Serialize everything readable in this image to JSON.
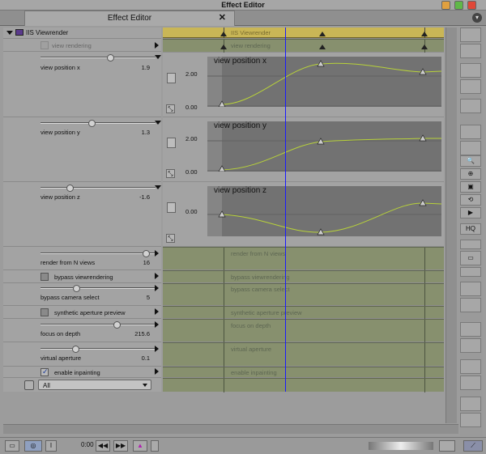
{
  "window": {
    "title": "Effect Editor"
  },
  "tab": {
    "label": "Effect Editor",
    "close": "✕"
  },
  "effect": {
    "name": "IIS Viewrender"
  },
  "params": {
    "view_rendering": {
      "label": "view rendering"
    },
    "view_position_x": {
      "label": "view position x",
      "value": "1.9",
      "slider": 0.62
    },
    "view_position_y": {
      "label": "view position y",
      "value": "1.3",
      "slider": 0.44
    },
    "view_position_z": {
      "label": "view position z",
      "value": "-1.6",
      "slider": 0.24
    },
    "render_from_n_views": {
      "label": "render from N views",
      "value": "16",
      "slider": 0.95
    },
    "bypass_viewrendering": {
      "label": "bypass viewrendering"
    },
    "bypass_camera_select": {
      "label": "bypass camera select",
      "value": "5",
      "slider": 0.3
    },
    "synthetic_aperture_preview": {
      "label": "synthetic aperture preview"
    },
    "focus_on_depth": {
      "label": "focus on depth",
      "value": "215.6",
      "slider": 0.68
    },
    "virtual_aperture": {
      "label": "virtual aperture",
      "value": "0.1",
      "slider": 0.29
    },
    "enable_inpainting": {
      "label": "enable inpainting",
      "checked": true
    },
    "filter_select": {
      "value": "All"
    }
  },
  "graphs": {
    "x": {
      "title": "view position x",
      "yticks": [
        "2.00",
        "0.00"
      ]
    },
    "y": {
      "title": "view position y",
      "yticks": [
        "2.00",
        "0.00"
      ]
    },
    "z": {
      "title": "view position z",
      "yticks": [
        "0.00"
      ]
    }
  },
  "tracks": {
    "iis_viewrender": "IIS Viewrender",
    "view_rendering": "view rendering",
    "render_from_n_views": "render from N views",
    "bypass_viewrendering": "bypass viewrendering",
    "bypass_camera_select": "bypass camera select",
    "synthetic_aperture_preview": "synthetic aperture preview",
    "focus_on_depth": "focus on depth",
    "virtual_aperture": "virtual aperture",
    "enable_inpainting": "enable inpainting"
  },
  "toolbar_right": {
    "hq": "HQ"
  },
  "bottom": {
    "timecode": "0:00"
  },
  "colors": {
    "accent_track": "#c9b656",
    "curve": "#b8d23a",
    "cursor": "#1a1aff",
    "track": "#87906e"
  }
}
